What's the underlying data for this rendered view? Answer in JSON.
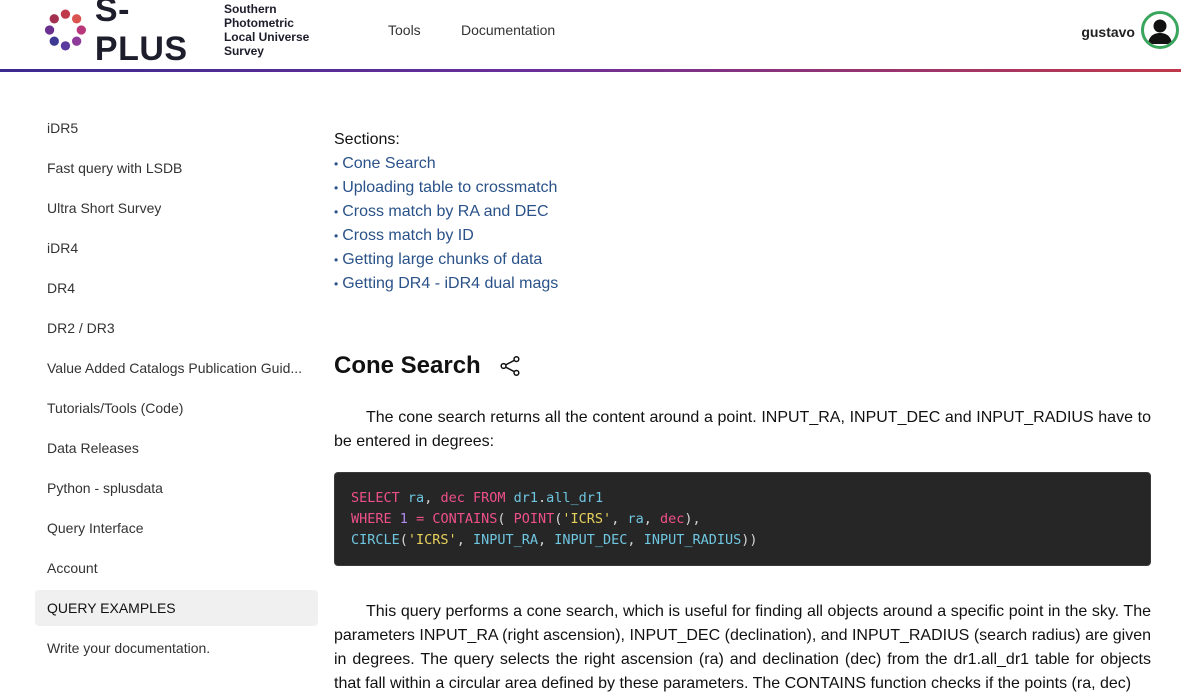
{
  "header": {
    "logo_text": "S-PLUS",
    "logo_sub_line1": "Southern Photometric",
    "logo_sub_line2": "Local Universe Survey",
    "nav": [
      "Tools",
      "Documentation"
    ],
    "username": "gustavo"
  },
  "colors": {
    "accent_link": "#2a5289",
    "code_bg": "#262626",
    "avatar_ring": "#3aa55d"
  },
  "sidebar": {
    "items": [
      {
        "label": "iDR5",
        "active": false
      },
      {
        "label": "Fast query with LSDB",
        "active": false
      },
      {
        "label": "Ultra Short Survey",
        "active": false
      },
      {
        "label": "iDR4",
        "active": false
      },
      {
        "label": "DR4",
        "active": false
      },
      {
        "label": "DR2 / DR3",
        "active": false
      },
      {
        "label": "Value Added Catalogs Publication Guid...",
        "active": false
      },
      {
        "label": "Tutorials/Tools (Code)",
        "active": false
      },
      {
        "label": "Data Releases",
        "active": false
      },
      {
        "label": "Python - splusdata",
        "active": false
      },
      {
        "label": "Query Interface",
        "active": false
      },
      {
        "label": "Account",
        "active": false
      },
      {
        "label": "QUERY EXAMPLES",
        "active": true
      },
      {
        "label": "Write your documentation.",
        "active": false
      }
    ]
  },
  "main": {
    "sections_label": "Sections:",
    "sections": [
      "Cone Search",
      "Uploading table to crossmatch",
      "Cross match by RA and DEC",
      "Cross match by ID",
      "Getting large chunks of data",
      "Getting DR4 - iDR4 dual mags"
    ],
    "heading": "Cone Search",
    "share_icon": "share-icon",
    "para1": "The cone search returns all the content around a point. INPUT_RA, INPUT_DEC and INPUT_RADIUS have to be entered in degrees:",
    "code": {
      "l1_kw1": "SELECT",
      "l1_id1": "ra",
      "l1_p1": ", ",
      "l1_id2": "dec",
      "l1_kw2": "FROM",
      "l1_id3": "dr1",
      "l1_p2": ".",
      "l1_id4": "all_dr1",
      "l2_kw1": "WHERE",
      "l2_num": "1",
      "l2_op": "=",
      "l2_fn1": "CONTAINS",
      "l2_p1": "( ",
      "l2_fn2": "POINT",
      "l2_p2": "(",
      "l2_str": "'ICRS'",
      "l2_p3": ", ",
      "l2_id1": "ra",
      "l2_p4": ", ",
      "l2_id2": "dec",
      "l2_p5": "),",
      "l3_fn": "CIRCLE",
      "l3_p1": "(",
      "l3_str": "'ICRS'",
      "l3_p2": ", ",
      "l3_id1": "INPUT_RA",
      "l3_p3": ", ",
      "l3_id2": "INPUT_DEC",
      "l3_p4": ", ",
      "l3_id3": "INPUT_RADIUS",
      "l3_p5": "))"
    },
    "para2": "This query performs a cone search, which is useful for finding all objects around a specific point in the sky. The parameters INPUT_RA (right ascension), INPUT_DEC (declination), and INPUT_RADIUS (search radius) are given in degrees. The query selects the right ascension (ra) and declination (dec) from the dr1.all_dr1 table for objects that fall within a circular area defined by these parameters. The CONTAINS function checks if the points (ra, dec)"
  }
}
